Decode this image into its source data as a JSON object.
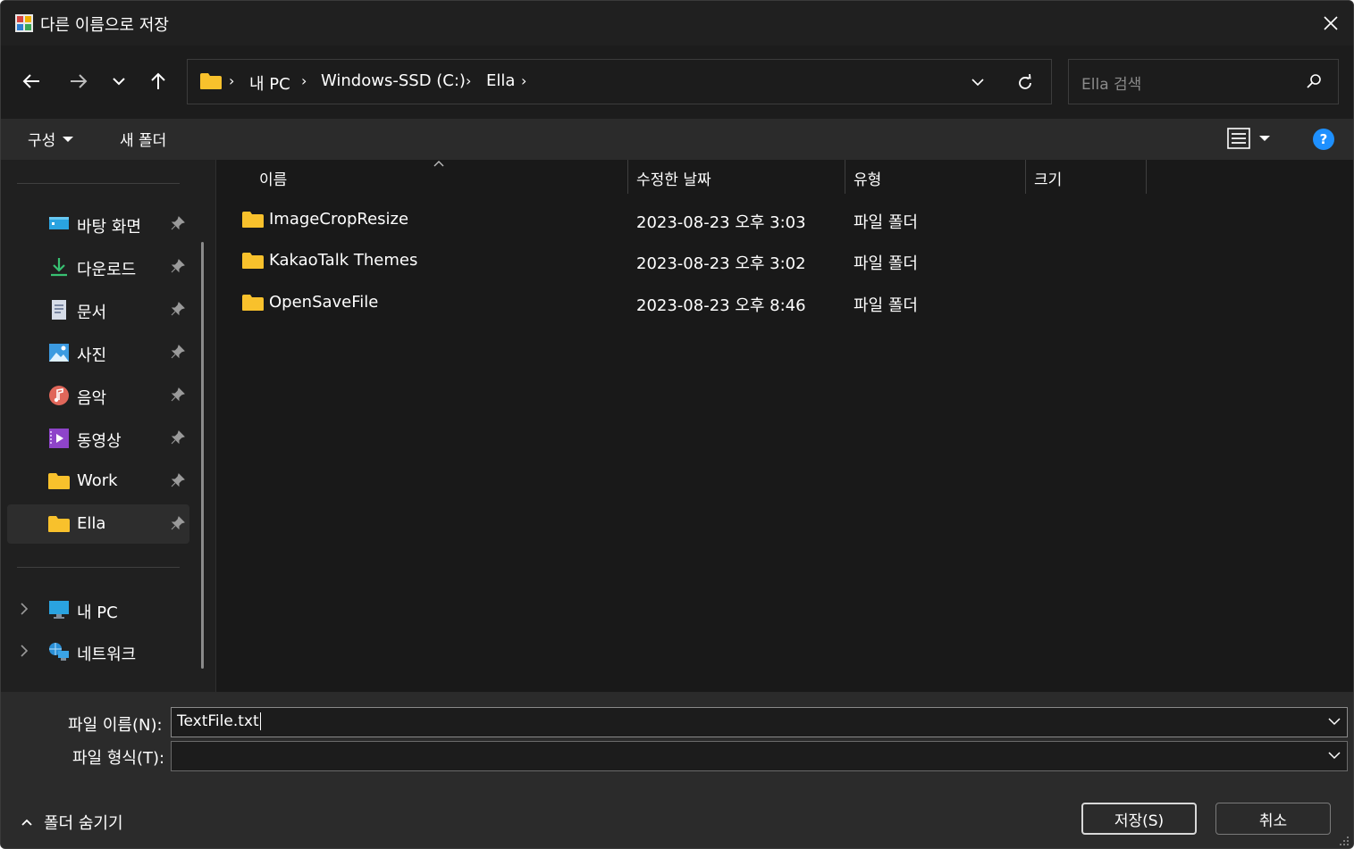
{
  "window": {
    "title": "다른 이름으로 저장"
  },
  "nav": {
    "breadcrumbs": [
      "내 PC",
      "Windows-SSD (C:)",
      "Ella"
    ],
    "search_placeholder": "Ella 검색"
  },
  "toolbar": {
    "organize": "구성",
    "new_folder": "새 폴더"
  },
  "sidebar": {
    "quick_access": [
      {
        "label": "바탕 화면",
        "icon": "desktop-icon",
        "pinned": true
      },
      {
        "label": "다운로드",
        "icon": "download-icon",
        "pinned": true
      },
      {
        "label": "문서",
        "icon": "document-icon",
        "pinned": true
      },
      {
        "label": "사진",
        "icon": "pictures-icon",
        "pinned": true
      },
      {
        "label": "음악",
        "icon": "music-icon",
        "pinned": true
      },
      {
        "label": "동영상",
        "icon": "video-icon",
        "pinned": true
      },
      {
        "label": "Work",
        "icon": "folder-icon",
        "pinned": true
      },
      {
        "label": "Ella",
        "icon": "folder-icon",
        "pinned": true,
        "selected": true
      }
    ],
    "locations": [
      {
        "label": "내 PC",
        "icon": "pc-icon"
      },
      {
        "label": "네트워크",
        "icon": "network-icon"
      }
    ]
  },
  "file_list": {
    "columns": [
      "이름",
      "수정한 날짜",
      "유형",
      "크기"
    ],
    "rows": [
      {
        "name": "ImageCropResize",
        "modified": "2023-08-23 오후 3:03",
        "type": "파일 폴더"
      },
      {
        "name": "KakaoTalk Themes",
        "modified": "2023-08-23 오후 3:02",
        "type": "파일 폴더"
      },
      {
        "name": "OpenSaveFile",
        "modified": "2023-08-23 오후 8:46",
        "type": "파일 폴더"
      }
    ]
  },
  "save_form": {
    "filename_label": "파일 이름(N):",
    "filename_value": "TextFile.txt",
    "filetype_label": "파일 형식(T):",
    "filetype_value": "",
    "hide_folders": "폴더 숨기기",
    "save_button": "저장(S)",
    "cancel_button": "취소"
  },
  "colors": {
    "background": "#202020",
    "list_bg": "#191919",
    "folder": "#f8c12c",
    "accent": "#1e90ff"
  }
}
